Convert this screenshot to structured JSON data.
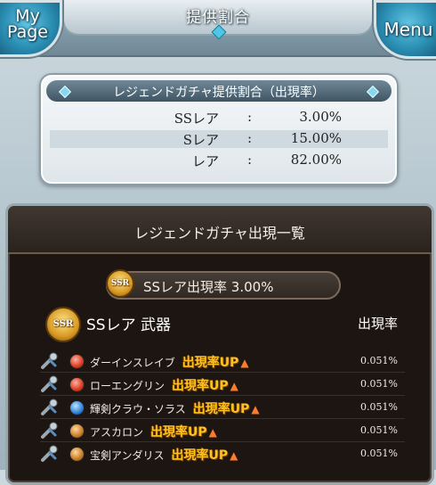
{
  "header": {
    "title": "提供割合",
    "mypage_label_1": "My",
    "mypage_label_2": "Page",
    "menu_label": "Menu"
  },
  "rates": {
    "title": "レジェンドガチャ提供割合（出現率）",
    "rows": [
      {
        "name": "SSレア",
        "colon": ":",
        "value": "3.00%"
      },
      {
        "name": "Sレア",
        "colon": ":",
        "value": "15.00%"
      },
      {
        "name": "レア",
        "colon": ":",
        "value": "82.00%"
      }
    ]
  },
  "list": {
    "title": "レジェンドガチャ出現一覧",
    "ssr_badge_text": "SSR",
    "ssr_rate_bar": "SSレア出現率 3.00%",
    "category_heading": "SSレア 武器",
    "rate_heading": "出現率",
    "items": [
      {
        "name": "ダーインスレイブ",
        "element": "fire",
        "tag": "出現率UP",
        "rate": "0.051%"
      },
      {
        "name": "ローエングリン",
        "element": "fire",
        "tag": "出現率UP",
        "rate": "0.051%"
      },
      {
        "name": "輝剣クラウ・ソラス",
        "element": "water",
        "tag": "出現率UP",
        "rate": "0.051%"
      },
      {
        "name": "アスカロン",
        "element": "earth",
        "tag": "出現率UP",
        "rate": "0.051%"
      },
      {
        "name": "宝剣アンダリス",
        "element": "earth",
        "tag": "出現率UP",
        "rate": "0.051%"
      }
    ]
  }
}
